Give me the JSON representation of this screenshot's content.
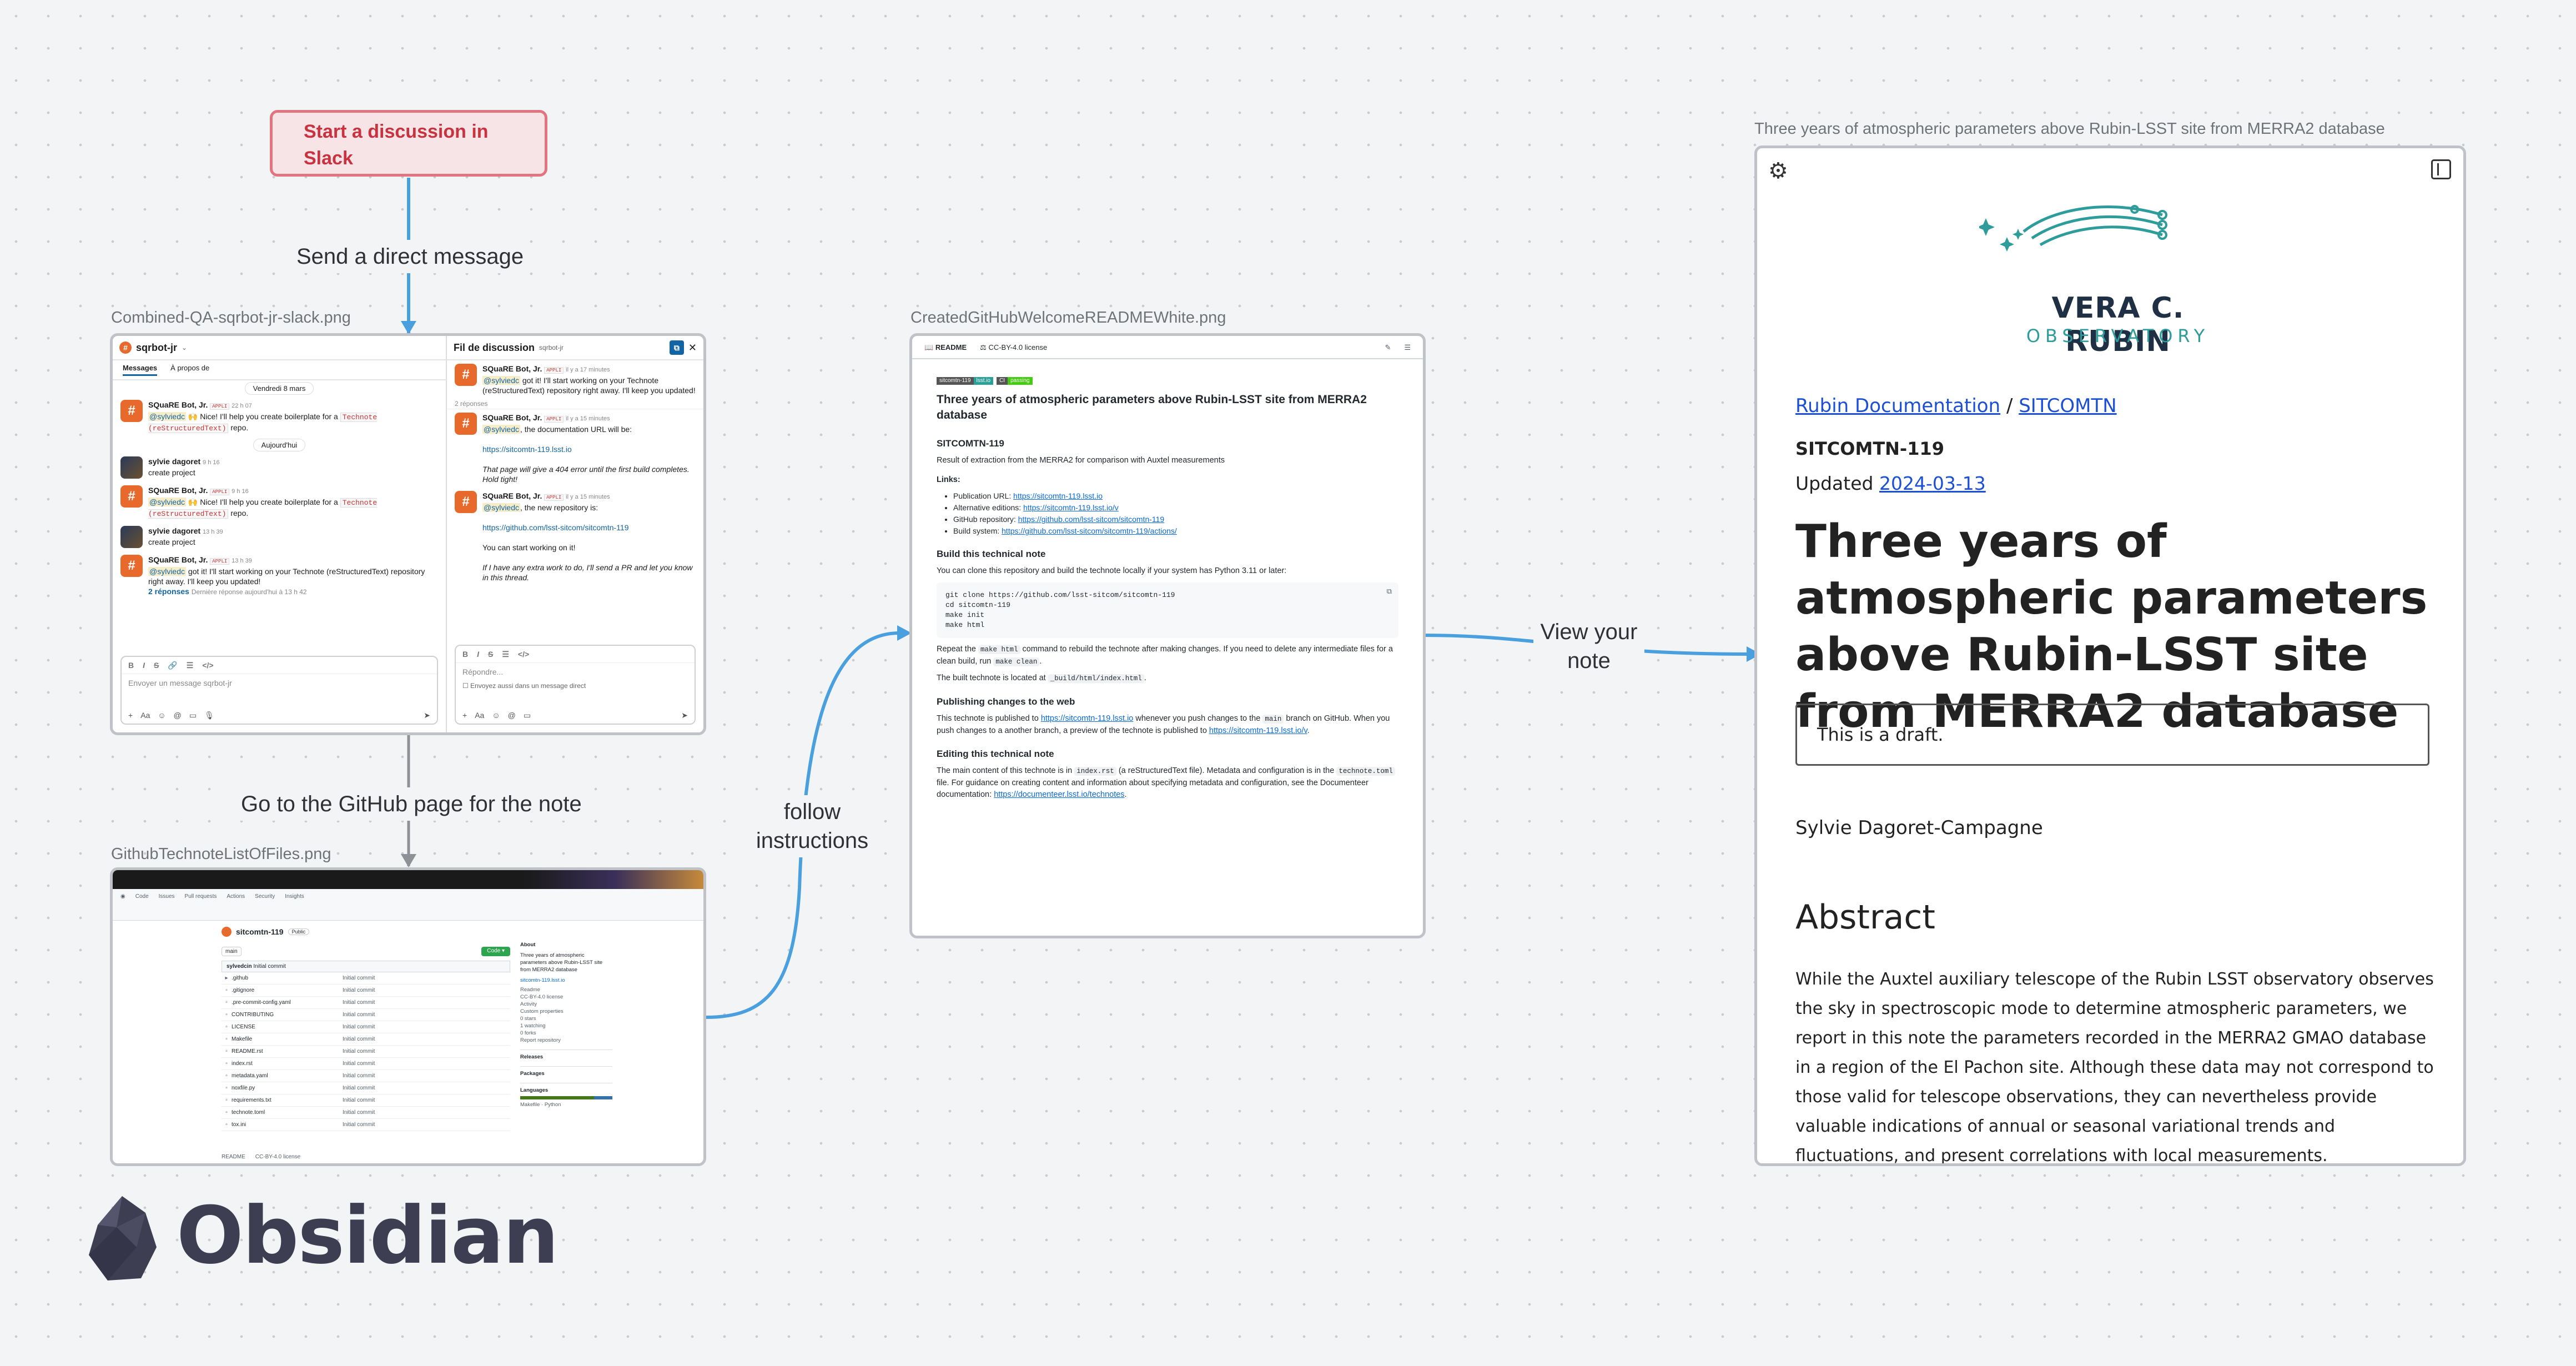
{
  "canvas": {
    "start_node": {
      "text": "Start a discussion in Slack"
    },
    "edges": [
      {
        "label": "Send a direct message"
      },
      {
        "label": "Go to the GitHub page for the note"
      },
      {
        "label": "follow instructions"
      },
      {
        "label": "View your note"
      }
    ],
    "files": {
      "slack": "Combined-QA-sqrbot-jr-slack.png",
      "github_files": "GithubTechnoteListOfFiles.png",
      "readme": "CreatedGitHubWelcomeREADMEWhite.png",
      "technote": "Three years of atmospheric parameters above Rubin-LSST site from MERRA2 database"
    },
    "brand": {
      "name": "Obsidian"
    }
  },
  "slack": {
    "channel": "sqrbot-jr",
    "tabs": [
      "Messages",
      "À propos de"
    ],
    "thread_title": "Fil de discussion",
    "thread_sub": "sqrbot-jr",
    "day1": "Vendredi 8 mars",
    "day2": "Aujourd'hui",
    "bot_name": "SQuaRE Bot, Jr.",
    "app_tag": "APPLI",
    "user_name": "sylvie dagoret",
    "mention": "@sylviedc",
    "messages": [
      {
        "time": "22 h 07",
        "pre": "Nice! I'll help you create boilerplate for a",
        "code": "Technote (reStructuredText)",
        "post": "repo."
      },
      {
        "time": "9 h 16",
        "text": "create project"
      },
      {
        "time": "9 h 16",
        "pre": "Nice! I'll help you create boilerplate for a",
        "code": "Technote (reStructuredText)",
        "post": "repo."
      },
      {
        "time": "13 h 39",
        "text": "create project"
      },
      {
        "time": "13 h 39",
        "text": "got it! I'll start working on your Technote (reStructuredText) repository right away. I'll keep you updated!"
      }
    ],
    "replies": "2 réponses",
    "replies_meta": "Dernière réponse aujourd'hui à 13 h 42",
    "composer_placeholder": "Envoyer un message sqrbot-jr",
    "thread": {
      "m1_time": "il y a 17 minutes",
      "m1_text": "got it! I'll start working on your Technote (reStructuredText) repository right away. I'll keep you updated!",
      "replies_count": "2 réponses",
      "m2_time": "il y a 15 minutes",
      "m2_text": ", the documentation URL will be:",
      "m2_link": "https://sitcomtn-119.lsst.io",
      "m2_note": "That page will give a 404 error until the first build completes. Hold tight!",
      "m3_time": "il y a 15 minutes",
      "m3_text": ", the new repository is:",
      "m3_link": "https://github.com/lsst-sitcom/sitcomtn-119",
      "m3_line": "You can start working on it!",
      "m3_note": "If I have any extra work to do, I'll send a PR and let you know in this thread.",
      "reply_placeholder": "Répondre...",
      "also_send": "Envoyez aussi dans un message direct"
    }
  },
  "github_files": {
    "repo": "sitcomtn-119",
    "visibility": "Public",
    "branch": "main",
    "commit_author": "sylvedcin",
    "commit_msg": "Initial commit",
    "files": [
      ".github",
      ".gitignore",
      ".pre-commit-config.yaml",
      "CONTRIBUTING",
      "LICENSE",
      "Makefile",
      "README.rst",
      "index.rst",
      "metadata.yaml",
      "noxfile.py",
      "requirements.txt",
      "technote.toml",
      "tox.ini"
    ],
    "row_time": "Initial commit",
    "about_heading": "About",
    "about_text": "Three years of atmospheric parameters above Rubin-LSST site from MERRA2 database",
    "about_link": "sitcomtn-119.lsst.io",
    "sidebar": [
      "Readme",
      "CC-BY-4.0 license",
      "Activity",
      "Custom properties",
      "0 stars",
      "1 watching",
      "0 forks",
      "Report repository"
    ],
    "releases": "Releases",
    "packages": "Packages",
    "languages": "Languages",
    "lang1": "Makefile",
    "lang2": "Python",
    "bottom_tabs": [
      "README",
      "CC-BY-4.0 license"
    ]
  },
  "readme": {
    "tabs": [
      "README",
      "CC-BY-4.0 license"
    ],
    "badges": [
      "sitcomtn-119",
      "lsst.io",
      "CI",
      "passing"
    ],
    "title": "Three years of atmospheric parameters above Rubin-LSST site from MERRA2 database",
    "id": "SITCOMTN-119",
    "summary": "Result of extraction from the MERRA2 for comparison with Auxtel measurements",
    "links_heading": "Links:",
    "links": [
      {
        "label": "Publication URL:",
        "url": "https://sitcomtn-119.lsst.io"
      },
      {
        "label": "Alternative editions:",
        "url": "https://sitcomtn-119.lsst.io/v"
      },
      {
        "label": "GitHub repository:",
        "url": "https://github.com/lsst-sitcom/sitcomtn-119"
      },
      {
        "label": "Build system:",
        "url": "https://github.com/lsst-sitcom/sitcomtn-119/actions/"
      }
    ],
    "build_heading": "Build this technical note",
    "build_intro": "You can clone this repository and build the technote locally if your system has Python 3.11 or later:",
    "code": "git clone https://github.com/lsst-sitcom/sitcomtn-119\ncd sitcomtn-119\nmake init\nmake html",
    "repeat_1": "Repeat the",
    "repeat_code": "make html",
    "repeat_2": "command to rebuild the technote after making changes. If you need to delete any intermediate files for a clean build, run",
    "repeat_code2": "make clean",
    "built_at": "The built technote is located at",
    "built_path": "_build/html/index.html",
    "pub_heading": "Publishing changes to the web",
    "pub_1": "This technote is published to",
    "pub_link": "https://sitcomtn-119.lsst.io",
    "pub_2": "whenever you push changes to the",
    "pub_code": "main",
    "pub_3": "branch on GitHub. When you push changes to a another branch, a preview of the technote is published to",
    "pub_link2": "https://sitcomtn-119.lsst.io/v",
    "edit_heading": "Editing this technical note",
    "edit_1": "The main content of this technote is in",
    "edit_code": "index.rst",
    "edit_2": "(a reStructuredText file). Metadata and configuration is in the",
    "edit_code2": "technote.toml",
    "edit_3": "file. For guidance on creating content and information about specifying metadata and configuration, see the Documenteer documentation:",
    "edit_link": "https://documenteer.lsst.io/technotes"
  },
  "technote": {
    "logo_line1": "VERA C. RUBIN",
    "logo_line2": "OBSERVATORY",
    "breadcrumb_1": "Rubin Documentation",
    "breadcrumb_sep": " / ",
    "breadcrumb_2": "SITCOMTN",
    "id": "SITCOMTN-119",
    "updated_label": "Updated ",
    "updated_date": "2024-03-13",
    "title": "Three years of atmospheric parameters above Rubin-LSST site from MERRA2 database",
    "draft": "This is a draft.",
    "author": "Sylvie Dagoret-Campagne",
    "abstract_heading": "Abstract",
    "abstract": "While the Auxtel auxiliary telescope of the Rubin LSST observatory observes the sky in spectroscopic mode to determine atmospheric parameters, we report in this note the parameters recorded in the MERRA2 GMAO database in a region of the El Pachon site. Although these data may not correspond to those valid for telescope observations, they can nevertheless provide valuable indications of annual or seasonal variational trends and fluctuations, and present correlations with local measurements."
  },
  "colors": {
    "edge": "#4a9fdf",
    "start_border": "#e0747f",
    "start_fill": "#f7e4e6",
    "start_text": "#c8333f",
    "rubin_teal": "#2d9c9a",
    "rubin_navy": "#1f3044"
  }
}
